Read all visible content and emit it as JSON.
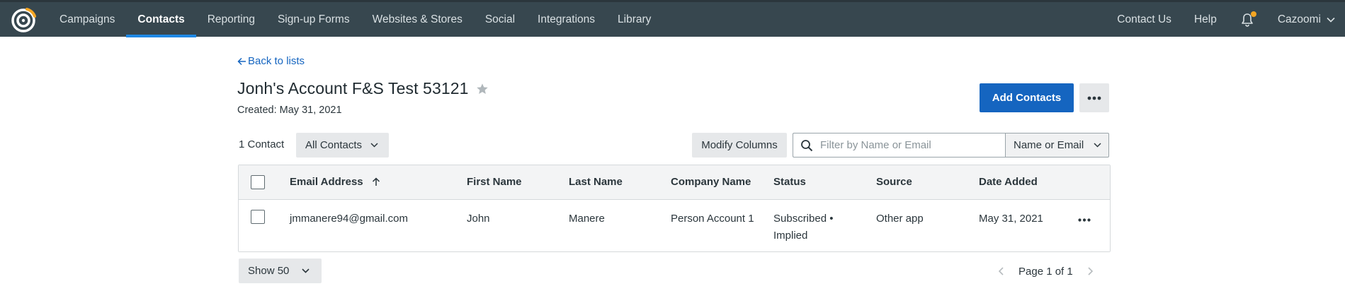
{
  "nav": {
    "items": [
      {
        "label": "Campaigns",
        "name": "nav-campaigns"
      },
      {
        "label": "Contacts",
        "name": "nav-contacts",
        "active": true
      },
      {
        "label": "Reporting",
        "name": "nav-reporting"
      },
      {
        "label": "Sign-up Forms",
        "name": "nav-signup-forms"
      },
      {
        "label": "Websites & Stores",
        "name": "nav-websites-stores"
      },
      {
        "label": "Social",
        "name": "nav-social"
      },
      {
        "label": "Integrations",
        "name": "nav-integrations"
      },
      {
        "label": "Library",
        "name": "nav-library"
      }
    ],
    "right": {
      "contact_us": "Contact Us",
      "help": "Help",
      "account": "Cazoomi"
    },
    "colors": {
      "bar": "#37474f",
      "active_underline": "#1e88e5",
      "notification_dot": "#f5a623"
    }
  },
  "page": {
    "back_link": "Back to lists",
    "title": "Jonh's Account F&S Test 53121",
    "created": "Created: May 31, 2021",
    "add_contacts": "Add Contacts",
    "contact_count": "1 Contact",
    "filter_selected": "All Contacts",
    "modify_columns": "Modify Columns",
    "search_placeholder": "Filter by Name or Email",
    "search_by": "Name or Email",
    "accent_color": "#1565c0"
  },
  "table": {
    "columns": [
      "Email Address",
      "First Name",
      "Last Name",
      "Company Name",
      "Status",
      "Source",
      "Date Added"
    ],
    "sort_column": "Email Address",
    "sort_direction": "ascending",
    "rows": [
      {
        "email": "jmmanere94@gmail.com",
        "first_name": "John",
        "last_name": "Manere",
        "company": "Person Account 1",
        "status_line1": "Subscribed •",
        "status_line2": "Implied",
        "source": "Other app",
        "date_added": "May 31, 2021"
      }
    ]
  },
  "footer": {
    "page_size": "Show 50",
    "pagination": "Page 1 of 1"
  },
  "icons": {
    "logo": "constant-contact-logo-icon",
    "back": "arrow-left-icon",
    "star": "star-icon",
    "more": "ellipsis-icon",
    "search": "search-icon",
    "sort": "arrow-up-icon",
    "dropdown": "chevron-down-icon",
    "bell": "bell-icon"
  }
}
